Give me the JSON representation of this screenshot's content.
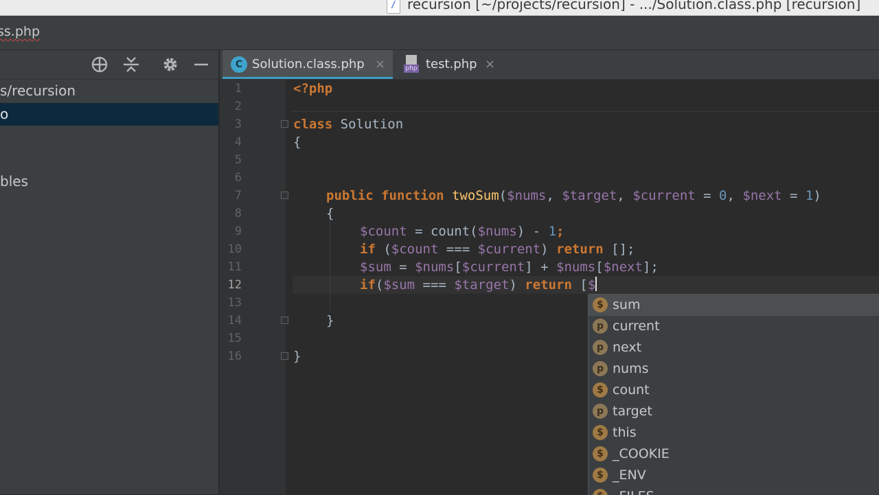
{
  "window": {
    "title": "recursion [~/projects/recursion] - .../Solution.class.php [recursion]",
    "title_icon": "php-file-icon"
  },
  "navbar": {
    "breadcrumb": "ss.php"
  },
  "project_panel": {
    "tree": [
      {
        "label": "s/recursion",
        "selected": false
      },
      {
        "label": "o",
        "selected": true
      },
      {
        "label": "bles",
        "selected": false
      }
    ]
  },
  "tabs": [
    {
      "label": "Solution.class.php",
      "icon": "class-icon",
      "icon_letter": "C",
      "active": true,
      "close": "×"
    },
    {
      "label": "test.php",
      "icon": "php-file-icon",
      "icon_badge": "php",
      "active": false,
      "close": "×"
    }
  ],
  "editor": {
    "current_line": 12,
    "lines": [
      {
        "n": "1"
      },
      {
        "n": "2"
      },
      {
        "n": "3"
      },
      {
        "n": "4"
      },
      {
        "n": "5"
      },
      {
        "n": "6"
      },
      {
        "n": "7"
      },
      {
        "n": "8"
      },
      {
        "n": "9"
      },
      {
        "n": "10"
      },
      {
        "n": "11"
      },
      {
        "n": "12"
      },
      {
        "n": "13"
      },
      {
        "n": "14"
      },
      {
        "n": "15"
      },
      {
        "n": "16"
      }
    ],
    "code": {
      "l1_tag": "<?php",
      "l3_kw": "class",
      "l3_name": " Solution",
      "l4_brace": "{",
      "l7_kw1": "public",
      "l7_kw2": " function",
      "l7_fn": " twoSum",
      "l7_p1": "(",
      "l7_v1": "$nums",
      "l7_c1": ", ",
      "l7_v2": "$target",
      "l7_c2": ", ",
      "l7_v3": "$current",
      "l7_eq1": " = ",
      "l7_n1": "0",
      "l7_c3": ", ",
      "l7_v4": "$next",
      "l7_eq2": " = ",
      "l7_n2": "1",
      "l7_p2": ")",
      "l8_brace": "{",
      "l9_v1": "$count",
      "l9_t1": " = count(",
      "l9_v2": "$nums",
      "l9_t2": ") - ",
      "l9_n1": "1",
      "l9_t3": ";",
      "l10_kw": "if",
      "l10_t1": " (",
      "l10_v1": "$count",
      "l10_t2": " === ",
      "l10_v2": "$current",
      "l10_t3": ") ",
      "l10_kw2": "return",
      "l10_t4": " [];",
      "l11_v1": "$sum",
      "l11_t1": " = ",
      "l11_v2": "$nums",
      "l11_t2": "[",
      "l11_v3": "$current",
      "l11_t3": "] + ",
      "l11_v4": "$nums",
      "l11_t4": "[",
      "l11_v5": "$next",
      "l11_t5": "];",
      "l12_kw": "if",
      "l12_t1": "(",
      "l12_v1": "$sum",
      "l12_t2": " === ",
      "l12_v2": "$target",
      "l12_t3": ") ",
      "l12_kw2": "return",
      "l12_t4": " [",
      "l12_v3": "$",
      "l14_brace": "}",
      "l16_brace": "}"
    }
  },
  "completion": {
    "items": [
      {
        "icon": "$",
        "kind": "variable",
        "label": "sum",
        "selected": true
      },
      {
        "icon": "p",
        "kind": "parameter",
        "label": "current",
        "selected": false
      },
      {
        "icon": "p",
        "kind": "parameter",
        "label": "next",
        "selected": false
      },
      {
        "icon": "p",
        "kind": "parameter",
        "label": "nums",
        "selected": false
      },
      {
        "icon": "$",
        "kind": "variable",
        "label": "count",
        "selected": false
      },
      {
        "icon": "p",
        "kind": "parameter",
        "label": "target",
        "selected": false
      },
      {
        "icon": "$",
        "kind": "variable",
        "label": "this",
        "selected": false
      },
      {
        "icon": "$",
        "kind": "variable",
        "label": "_COOKIE",
        "selected": false
      },
      {
        "icon": "$",
        "kind": "variable",
        "label": "_ENV",
        "selected": false
      },
      {
        "icon": "$",
        "kind": "variable",
        "label": "_FILES",
        "selected": false
      }
    ]
  },
  "colors": {
    "keyword": "#cc7832",
    "variable": "#9876aa",
    "number": "#6897bb",
    "function": "#ffc66d",
    "text": "#a9b7c6",
    "tab_accent": "#3d9cc4",
    "selection": "#0d293e"
  }
}
